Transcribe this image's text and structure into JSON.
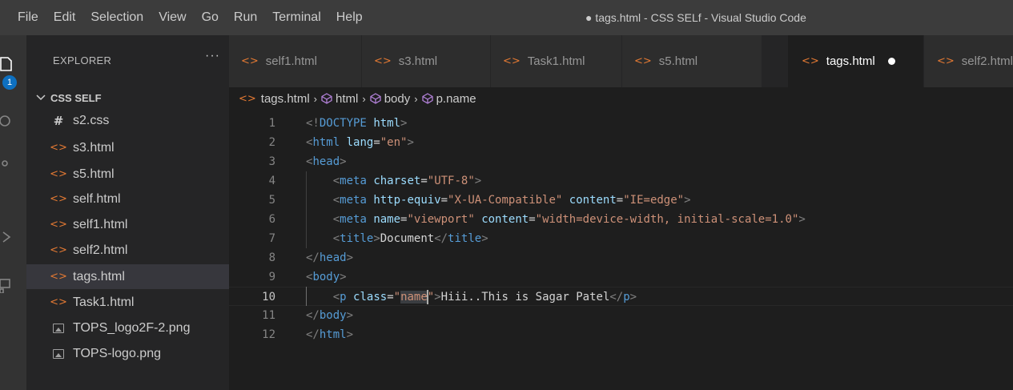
{
  "menu": [
    "File",
    "Edit",
    "Selection",
    "View",
    "Go",
    "Run",
    "Terminal",
    "Help"
  ],
  "window_title": "● tags.html - CSS SELf - Visual Studio Code",
  "activity": {
    "badge": "1"
  },
  "sidebar": {
    "header": "EXPLORER",
    "more": "···",
    "folder": "CSS SELF",
    "files": [
      {
        "name": "s2.css",
        "type": "css"
      },
      {
        "name": "s3.html",
        "type": "html"
      },
      {
        "name": "s5.html",
        "type": "html"
      },
      {
        "name": "self.html",
        "type": "html"
      },
      {
        "name": "self1.html",
        "type": "html"
      },
      {
        "name": "self2.html",
        "type": "html"
      },
      {
        "name": "tags.html",
        "type": "html",
        "active": true
      },
      {
        "name": "Task1.html",
        "type": "html"
      },
      {
        "name": "TOPS_logo2F-2.png",
        "type": "image"
      },
      {
        "name": "TOPS-logo.png",
        "type": "image"
      }
    ]
  },
  "tabs": [
    {
      "label": "self1.html",
      "active": false
    },
    {
      "label": "s3.html",
      "active": false
    },
    {
      "label": "Task1.html",
      "active": false
    },
    {
      "label": "s5.html",
      "active": false
    },
    {
      "label": "tags.html",
      "active": true,
      "dirty": true
    },
    {
      "label": "self2.html",
      "active": false
    }
  ],
  "icon_glyphs": {
    "html": "<>",
    "css": "#"
  },
  "breadcrumb": [
    "tags.html",
    "html",
    "body",
    "p.name"
  ],
  "editor": {
    "current_line": 10,
    "line_numbers": [
      "1",
      "2",
      "3",
      "4",
      "5",
      "6",
      "7",
      "8",
      "9",
      "10",
      "11",
      "12"
    ],
    "lines": [
      "<!DOCTYPE html>",
      "<html lang=\"en\">",
      "<head>",
      "    <meta charset=\"UTF-8\">",
      "    <meta http-equiv=\"X-UA-Compatible\" content=\"IE=edge\">",
      "    <meta name=\"viewport\" content=\"width=device-width, initial-scale=1.0\">",
      "    <title>Document</title>",
      "</head>",
      "<body>",
      "    <p class=\"name\">Hiii..This is Sagar Patel</p>",
      "</body>",
      "</html>"
    ]
  },
  "colors": {
    "title_bar": "#3c3c3c",
    "sidebar": "#252526",
    "editor": "#1e1e1e",
    "tag": "#569cd6",
    "attribute": "#9cdcfe",
    "string": "#ce9178",
    "html_icon": "#e37933"
  }
}
